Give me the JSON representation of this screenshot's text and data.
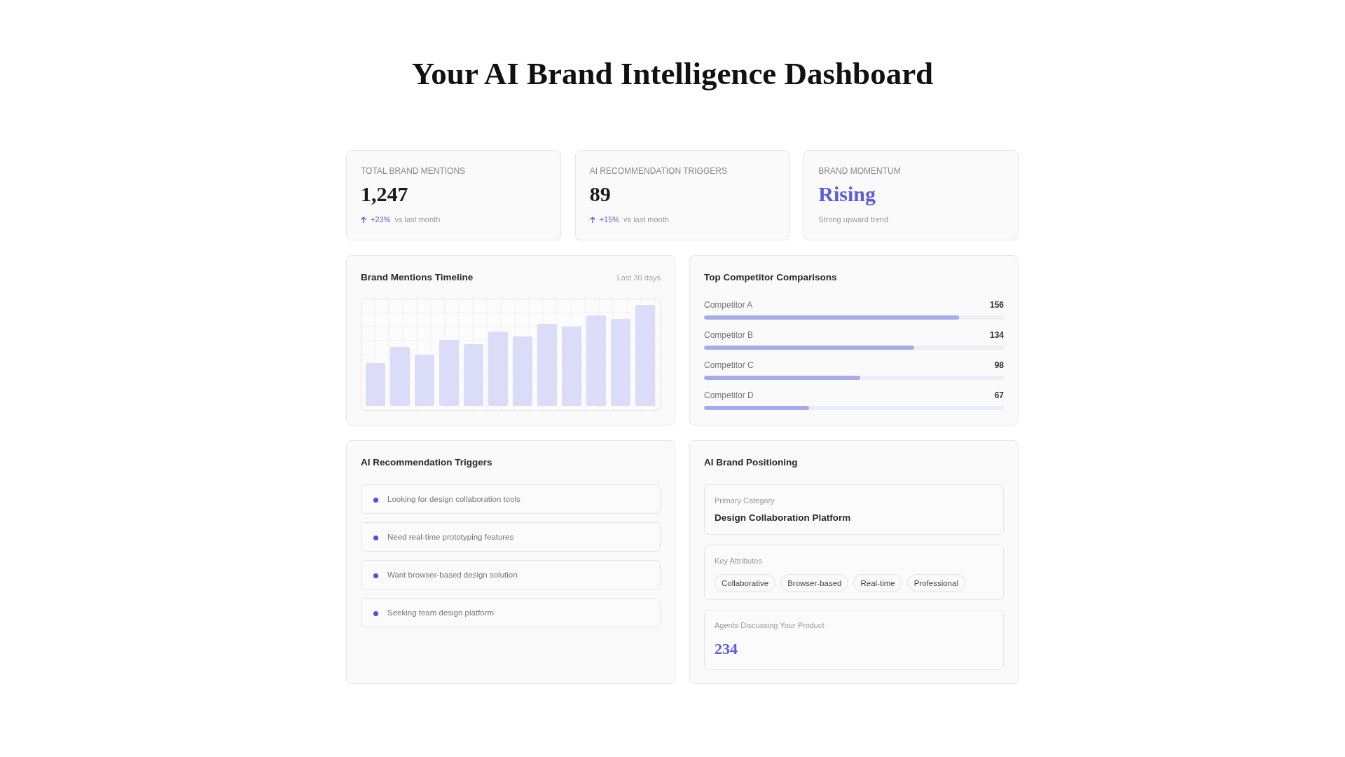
{
  "page": {
    "title": "Your AI Brand Intelligence Dashboard"
  },
  "stats": [
    {
      "kind": "change",
      "label": "TOTAL BRAND MENTIONS",
      "value": "1,247",
      "change": "+23%",
      "note": "vs last month"
    },
    {
      "kind": "change",
      "label": "AI RECOMMENDATION TRIGGERS",
      "value": "89",
      "change": "+15%",
      "note": "vs last month"
    },
    {
      "kind": "status",
      "label": "BRAND MOMENTUM",
      "value": "Rising",
      "note": "Strong upward trend"
    }
  ],
  "timeline": {
    "title": "Brand Mentions Timeline",
    "period": "Last 30 days"
  },
  "competitors": {
    "title": "Top Competitor Comparisons",
    "items": [
      {
        "name": "Competitor A",
        "value": "156",
        "level": 0.85
      },
      {
        "name": "Competitor B",
        "value": "134",
        "level": 0.7
      },
      {
        "name": "Competitor C",
        "value": "98",
        "level": 0.52
      },
      {
        "name": "Competitor D",
        "value": "67",
        "level": 0.35
      }
    ]
  },
  "triggers": {
    "title": "AI Recommendation Triggers",
    "items": [
      "Looking for design collaboration tools",
      "Need real-time prototyping features",
      "Want browser-based design solution",
      "Seeking team design platform"
    ]
  },
  "positioning": {
    "title": "AI Brand Positioning",
    "primary_category": {
      "label": "Primary Category",
      "value": "Design Collaboration Platform"
    },
    "key_attributes": {
      "label": "Key Attributes",
      "tags": [
        "Collaborative",
        "Browser-based",
        "Real-time",
        "Professional"
      ]
    },
    "agents": {
      "label": "Agents Discussing Your Product",
      "value": "234"
    }
  }
}
